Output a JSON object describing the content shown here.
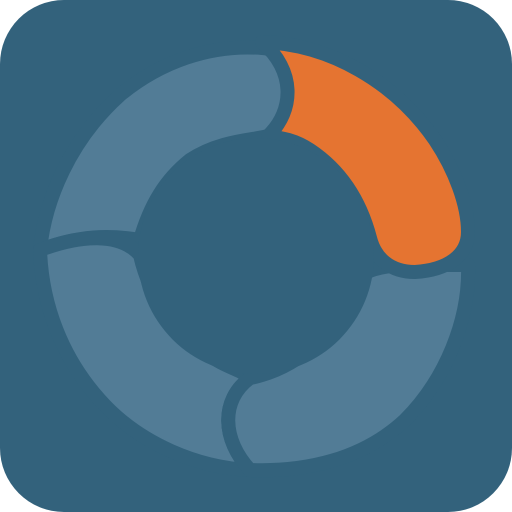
{
  "icon": {
    "name": "app-icon",
    "shape": "rounded-square",
    "symbol": "four-segment-ring",
    "colors": {
      "background": "#33627c",
      "segment_muted": "#527c96",
      "segment_accent": "#e57431",
      "hole": "#33627c"
    },
    "segments": [
      {
        "name": "ring-segment-top-right",
        "color_key": "segment_accent"
      },
      {
        "name": "ring-segment-bottom-right",
        "color_key": "segment_muted"
      },
      {
        "name": "ring-segment-bottom-left",
        "color_key": "segment_muted"
      },
      {
        "name": "ring-segment-top-left",
        "color_key": "segment_muted"
      }
    ]
  }
}
